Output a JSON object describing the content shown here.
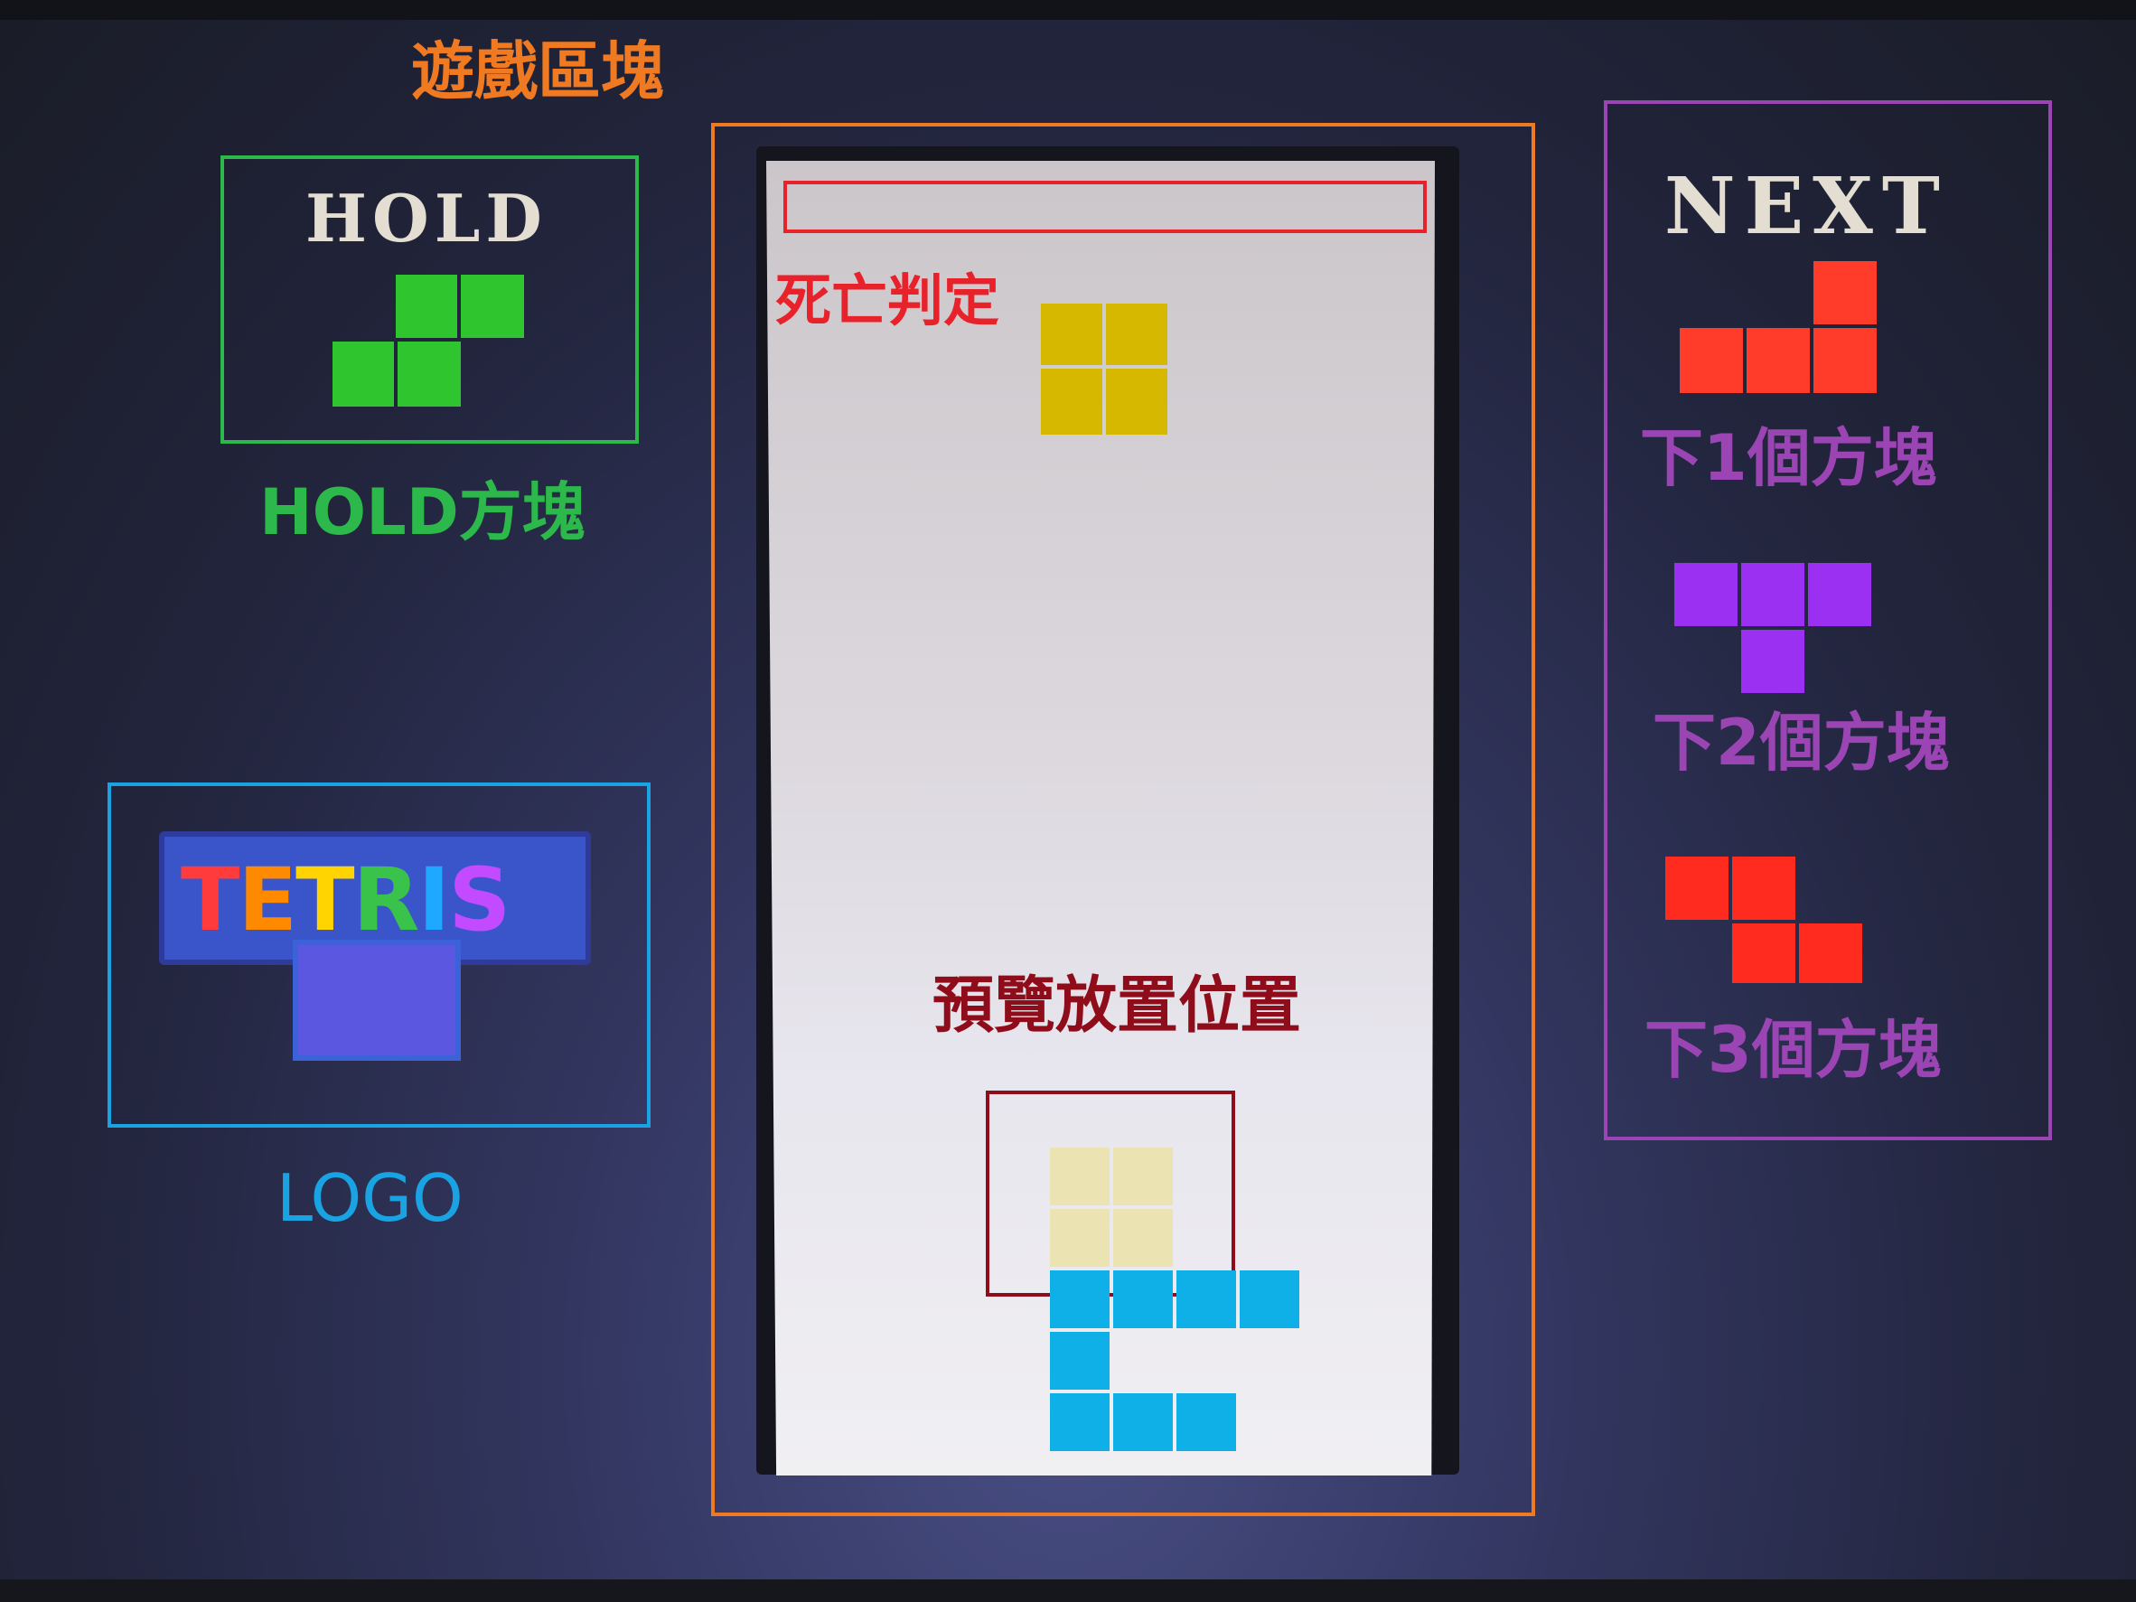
{
  "annotations": {
    "game_area": "遊戲區塊",
    "death_zone": "死亡判定",
    "preview": "預覽放置位置",
    "hold_block": "HOLD方塊",
    "logo": "LOGO",
    "next1": "下1個方塊",
    "next2": "下2個方塊",
    "next3": "下3個方塊"
  },
  "game": {
    "hold_title": "HOLD",
    "next_title": "NEXT",
    "logo_text": "TETRIS",
    "logo_letters": [
      "T",
      "E",
      "T",
      "R",
      "I",
      "S"
    ]
  },
  "pieces": {
    "hold": {
      "type": "S",
      "color": "#2ec52e"
    },
    "falling": {
      "type": "O",
      "color": "#d6b800"
    },
    "ghost": {
      "type": "O",
      "color": "#ece3b2"
    },
    "next": [
      {
        "type": "L",
        "color": "#ff3b2a"
      },
      {
        "type": "T",
        "color": "#9b2ff2"
      },
      {
        "type": "Z",
        "color": "#ff2b1f"
      }
    ],
    "stack_color": "#0fb0e8"
  },
  "colors": {
    "game_area_outline": "#f07a22",
    "death_outline": "#e8222b",
    "preview_outline": "#8f0d1a",
    "hold_outline": "#2cb84a",
    "logo_outline": "#1aa3e3",
    "next_outline": "#9b45b4",
    "hold_label": "#2cb84a",
    "logo_label": "#1aa3e3",
    "next_label": "#9b45b4",
    "game_label": "#f07a22",
    "death_label": "#e8222b",
    "preview_label": "#8f0d1a"
  },
  "logo_colors": [
    "#ff3b3b",
    "#ff8a00",
    "#ffd400",
    "#39c34a",
    "#1fa8ff",
    "#c24bff"
  ]
}
